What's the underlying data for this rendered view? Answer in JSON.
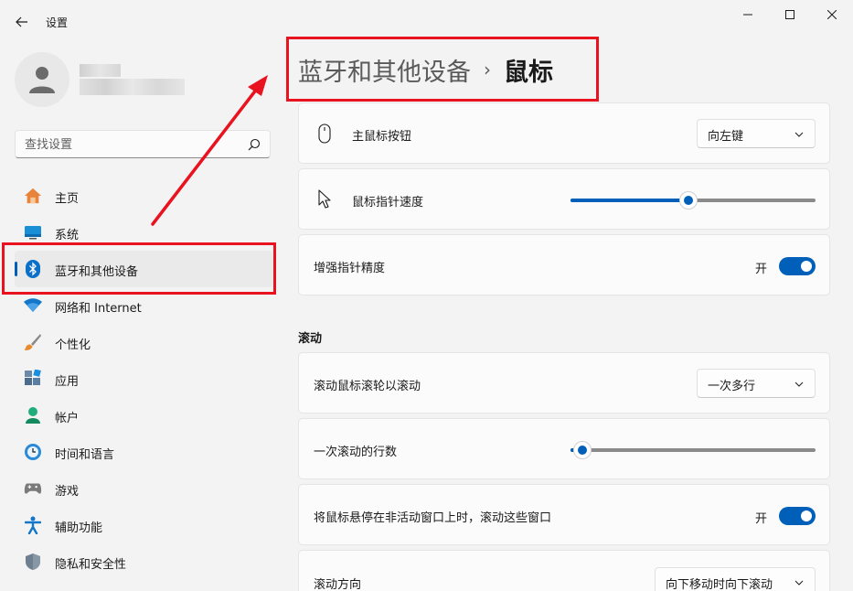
{
  "window": {
    "title": "设置"
  },
  "search": {
    "placeholder": "查找设置"
  },
  "sidebar": {
    "items": [
      {
        "label": "主页",
        "icon": "home-icon"
      },
      {
        "label": "系统",
        "icon": "monitor-icon"
      },
      {
        "label": "蓝牙和其他设备",
        "icon": "bluetooth-icon",
        "active": true
      },
      {
        "label": "网络和 Internet",
        "icon": "wifi-icon"
      },
      {
        "label": "个性化",
        "icon": "brush-icon"
      },
      {
        "label": "应用",
        "icon": "apps-icon"
      },
      {
        "label": "帐户",
        "icon": "account-icon"
      },
      {
        "label": "时间和语言",
        "icon": "clock-globe-icon"
      },
      {
        "label": "游戏",
        "icon": "gamepad-icon"
      },
      {
        "label": "辅助功能",
        "icon": "accessibility-icon"
      },
      {
        "label": "隐私和安全性",
        "icon": "shield-icon"
      }
    ]
  },
  "breadcrumb": {
    "parent": "蓝牙和其他设备",
    "separator": "›",
    "current": "鼠标"
  },
  "settings": {
    "primary_button": {
      "label": "主鼠标按钮",
      "value": "向左键",
      "icon": "mouse-icon"
    },
    "pointer_speed": {
      "label": "鼠标指针速度",
      "value": 0.48,
      "icon": "cursor-icon"
    },
    "enhance_precision": {
      "label": "增强指针精度",
      "state": "开",
      "on": true
    },
    "scroll_section": "滚动",
    "scroll_wheel": {
      "label": "滚动鼠标滚轮以滚动",
      "value": "一次多行"
    },
    "lines_per_scroll": {
      "label": "一次滚动的行数",
      "value": 0.05
    },
    "inactive_scroll": {
      "label": "将鼠标悬停在非活动窗口上时，滚动这些窗口",
      "state": "开",
      "on": true
    },
    "scroll_direction": {
      "label": "滚动方向",
      "value": "向下移动时向下滚动"
    }
  },
  "colors": {
    "accent": "#005fb8",
    "annotation": "#e8131f"
  }
}
